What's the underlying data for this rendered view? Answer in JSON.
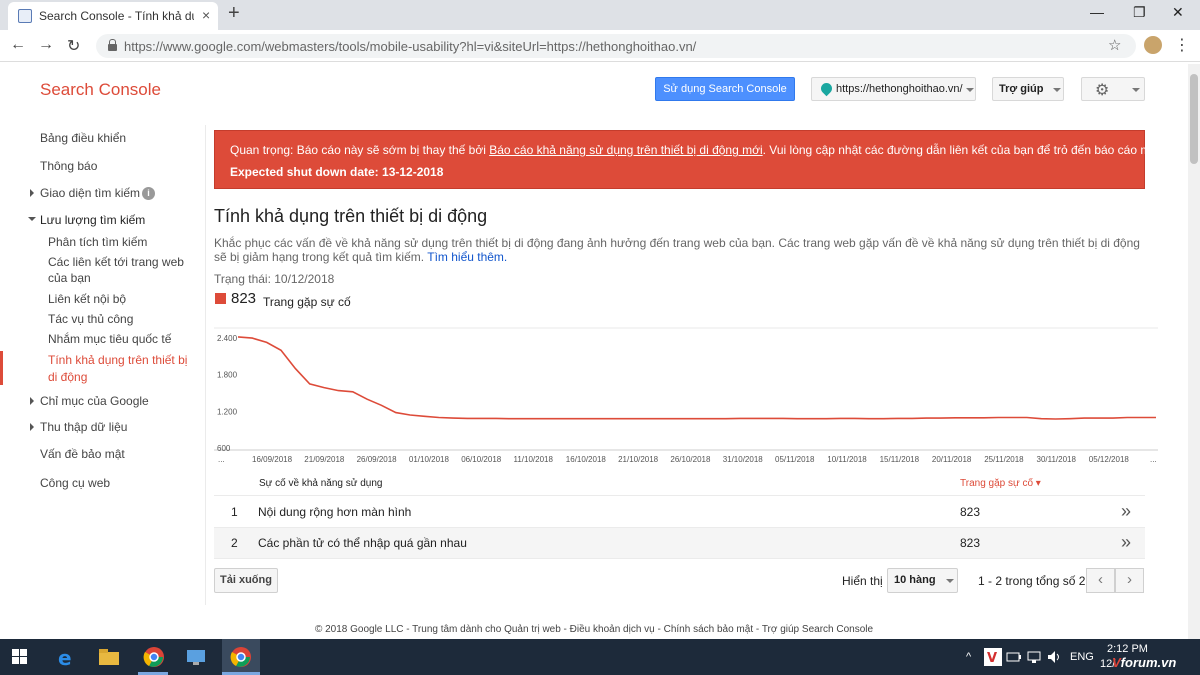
{
  "browser": {
    "tab_title": "Search Console - Tính khả dụng t",
    "tab_close": "×",
    "new_tab": "+",
    "url": "https://www.google.com/webmasters/tools/mobile-usability?hl=vi&siteUrl=https://hethonghoithao.vn/",
    "window_controls": {
      "minimize": "—",
      "maximize": "❐",
      "close": "✕"
    },
    "nav": {
      "back": "←",
      "forward": "→",
      "reload": "↻"
    },
    "star": "☆",
    "menu": "⋮"
  },
  "header": {
    "brand": "Search Console",
    "new_console_button": "Sử dụng Search Console mới",
    "site_selector": "https://hethonghoithao.vn/",
    "help_button": "Trợ giúp",
    "settings_icon": "⚙"
  },
  "sidebar": {
    "items": [
      {
        "label": "Bảng điều khiển"
      },
      {
        "label": "Thông báo"
      },
      {
        "label": "Giao diện tìm kiếm"
      },
      {
        "label": "Lưu lượng tìm kiếm"
      },
      {
        "label": "Chỉ mục của Google"
      },
      {
        "label": "Thu thập dữ liệu"
      },
      {
        "label": "Vấn đề bảo mật"
      },
      {
        "label": "Công cụ web"
      }
    ],
    "sub_items": [
      {
        "label": "Phân tích tìm kiếm"
      },
      {
        "label": "Các liên kết tới trang web của bạn"
      },
      {
        "label": "Liên kết nội bộ"
      },
      {
        "label": "Tác vụ thủ công"
      },
      {
        "label": "Nhắm mục tiêu quốc tế"
      },
      {
        "label": "Tính khả dụng trên thiết bị di động"
      }
    ],
    "info_icon": "i"
  },
  "alert": {
    "prefix": "Quan trọng: Báo cáo này sẽ sớm bị thay thế bởi ",
    "link": "Báo cáo khả năng sử dụng trên thiết bị di động mới",
    "suffix": ". Vui lòng cập nhật các đường dẫn liên kết của bạn để trỏ đến báo cáo mới.",
    "shutdown": "Expected shut down date: 13-12-2018"
  },
  "main": {
    "title": "Tính khả dụng trên thiết bị di động",
    "description": "Khắc phục các vấn đề về khả năng sử dụng trên thiết bị di động đang ảnh hưởng đến trang web của bạn. Các trang web gặp vấn đề về khả năng sử dụng trên thiết bị di động sẽ bị giảm hạng trong kết quả tìm kiếm. ",
    "learn_more": "Tìm hiểu thêm.",
    "status": "Trạng thái: 10/12/2018",
    "legend_value": "823",
    "legend_label": "Trang gặp sự cố"
  },
  "chart_data": {
    "type": "line",
    "y_ticks": [
      "2.400",
      "1.800",
      "1.200",
      "600"
    ],
    "x_ticks": [
      "...",
      "16/09/2018",
      "21/09/2018",
      "26/09/2018",
      "01/10/2018",
      "06/10/2018",
      "11/10/2018",
      "16/10/2018",
      "21/10/2018",
      "26/10/2018",
      "31/10/2018",
      "05/11/2018",
      "10/11/2018",
      "15/11/2018",
      "20/11/2018",
      "25/11/2018",
      "30/11/2018",
      "05/12/2018",
      "..."
    ],
    "ylim": [
      600,
      2500
    ],
    "color": "#dd4b39",
    "series": [
      {
        "values": [
          2420,
          2400,
          2330,
          2200,
          1900,
          1650,
          1590,
          1540,
          1520,
          1400,
          1300,
          1180,
          1140,
          1120,
          1100,
          1090,
          1085,
          1085,
          1085,
          1080,
          1080,
          1080,
          1080,
          1080,
          1080,
          1080,
          1080,
          1080,
          1080,
          1080,
          1080,
          1080,
          1080,
          1080,
          1080,
          1085,
          1085,
          1085,
          1085,
          1080,
          1080,
          1080,
          1085,
          1085,
          1080,
          1080,
          1085,
          1085,
          1090,
          1090,
          1095,
          1095,
          1095,
          1100,
          1100,
          1100,
          1080,
          1075,
          1080,
          1090,
          1090,
          1090,
          1100,
          1100,
          1100
        ]
      }
    ]
  },
  "table": {
    "col_issue": "Sự cố về khả năng sử dụng",
    "col_pages": "Trang gặp sự cố ▾",
    "rows": [
      {
        "idx": "1",
        "name": "Nội dung rộng hơn màn hình",
        "value": "823"
      },
      {
        "idx": "2",
        "name": "Các phần tử có thể nhập quá gần nhau",
        "value": "823"
      }
    ],
    "go_icon": "»"
  },
  "pagination": {
    "download": "Tải xuống",
    "show_label": "Hiển thị",
    "rows_per_page": "10 hàng",
    "range": "1 - 2 trong tổng số 2",
    "prev": "‹",
    "next": "›"
  },
  "footer": {
    "text": "© 2018 Google LLC - Trung tâm dành cho Quản trị web - Điều khoản dịch vụ - Chính sách bảo mật - Trợ giúp Search Console"
  },
  "taskbar": {
    "lang": "ENG",
    "time": "2:12 PM",
    "date": "12/",
    "tray_arrow": "^",
    "watermark_a": "V",
    "watermark_b": "forum.vn"
  }
}
